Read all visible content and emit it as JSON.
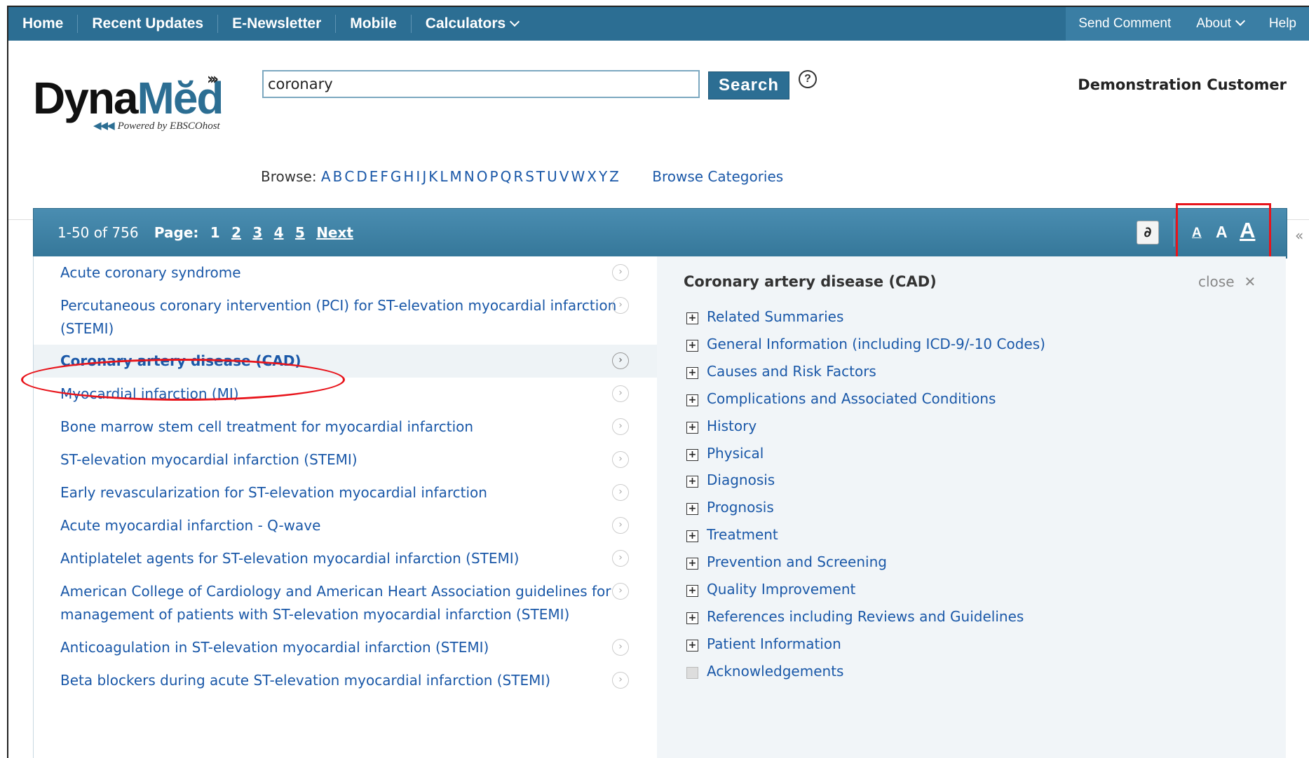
{
  "topnav": {
    "left": [
      "Home",
      "Recent Updates",
      "E-Newsletter",
      "Mobile",
      "Calculators"
    ],
    "right": [
      "Send Comment",
      "About",
      "Help"
    ]
  },
  "logo": {
    "dyna": "Dyna",
    "med": "Mĕd",
    "powered": "Powered by EBSCOhost"
  },
  "search": {
    "value": "coronary",
    "button": "Search",
    "help": "?"
  },
  "user": {
    "name": "Demonstration Customer"
  },
  "browse": {
    "label": "Browse:",
    "letters": [
      "A",
      "B",
      "C",
      "D",
      "E",
      "F",
      "G",
      "H",
      "I",
      "J",
      "K",
      "L",
      "M",
      "N",
      "O",
      "P",
      "Q",
      "R",
      "S",
      "T",
      "U",
      "V",
      "W",
      "X",
      "Y",
      "Z"
    ],
    "categories": "Browse Categories"
  },
  "results": {
    "range": "1-50 of 756",
    "page_label": "Page:",
    "pages": [
      "1",
      "2",
      "3",
      "4",
      "5"
    ],
    "next": "Next",
    "link_icon": "∂",
    "font_small": "A",
    "font_medium": "A",
    "font_large": "A",
    "collapse": "«"
  },
  "list": [
    {
      "text": "Acute coronary syndrome"
    },
    {
      "text": "Percutaneous coronary intervention (PCI) for ST-elevation myocardial infarction (STEMI)"
    },
    {
      "text": "Coronary artery disease (CAD)",
      "selected": true
    },
    {
      "text": "Myocardial infarction (MI)"
    },
    {
      "text": "Bone marrow stem cell treatment for myocardial infarction"
    },
    {
      "text": "ST-elevation myocardial infarction (STEMI)"
    },
    {
      "text": "Early revascularization for ST-elevation myocardial infarction"
    },
    {
      "text": "Acute myocardial infarction - Q-wave"
    },
    {
      "text": "Antiplatelet agents for ST-elevation myocardial infarction (STEMI)"
    },
    {
      "text": "American College of Cardiology and American Heart Association guidelines for management of patients with ST-elevation myocardial infarction (STEMI)"
    },
    {
      "text": "Anticoagulation in ST-elevation myocardial infarction (STEMI)"
    },
    {
      "text": "Beta blockers during acute ST-elevation myocardial infarction (STEMI)"
    }
  ],
  "detail": {
    "title": "Coronary artery disease (CAD)",
    "close": "close",
    "close_x": "✕",
    "sections": [
      "Related Summaries",
      "General Information (including ICD-9/-10 Codes)",
      "Causes and Risk Factors",
      "Complications and Associated Conditions",
      "History",
      "Physical",
      "Diagnosis",
      "Prognosis",
      "Treatment",
      "Prevention and Screening",
      "Quality Improvement",
      "References including Reviews and Guidelines",
      "Patient Information",
      "Acknowledgements"
    ]
  }
}
